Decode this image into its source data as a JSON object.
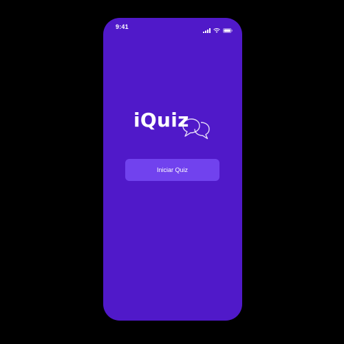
{
  "status_bar": {
    "time": "9:41",
    "icons": [
      "signal-icon",
      "wifi-icon",
      "battery-icon"
    ]
  },
  "logo": {
    "text": "iQuiz",
    "decoration": "speech-bubbles-icon"
  },
  "main": {
    "start_button_label": "Iniciar Quiz"
  },
  "colors": {
    "background": "#5019c9",
    "button": "#7142ee",
    "text": "#ffffff",
    "frame": "#000000"
  }
}
